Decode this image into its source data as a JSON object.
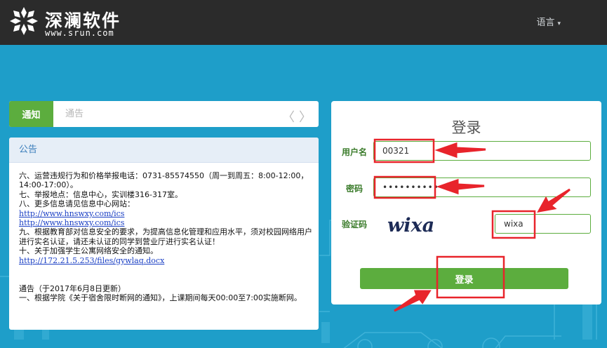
{
  "header": {
    "brand_name": "深澜软件",
    "brand_url": "www.srun.com",
    "language_label": "语言",
    "caret": "▾"
  },
  "tabs": {
    "active": "通知",
    "inactive": "通告",
    "prev": "〈",
    "next": "〉"
  },
  "notice": {
    "heading": "公告",
    "lines": [
      "六、运营违规行为和价格举报电话：0731-85574550（周一到周五：8:00-12:00，14:00-17:00）。",
      "七、举报地点：信息中心，实训楼316-317室。",
      "八、更多信息请见信息中心网站："
    ],
    "links": [
      "http://www.hnswxy.com/ics",
      "http://www.hnswxy.com/ics"
    ],
    "lines2": [
      "九、根据教育部对信息安全的要求，为提高信息化管理和应用水平，须对校园网络用户进行实名认证，请还未认证的同学到营业厅进行实名认证！",
      "十、关于加强学生公寓网络安全的通知。"
    ],
    "link3": "http://172.21.5.253/files/gywlaq.docx",
    "lines3": [
      "通告（于2017年6月8日更新）",
      "一、根据学院《关于宿舍限时断网的通知》，上课期间每天00:00至7:00实施断网。"
    ]
  },
  "login": {
    "title": "登录",
    "username_label": "用户名",
    "username_value": "00321",
    "password_label": "密码",
    "password_value": "••••••••••••",
    "captcha_label": "验证码",
    "captcha_image_text": "wixa",
    "captcha_value": "wixa",
    "submit_label": "登录"
  },
  "colors": {
    "header_bg": "#2b2b2b",
    "page_bg": "#1e9ec9",
    "accent_green": "#5cad3e",
    "annotation_red": "#e8242b"
  }
}
